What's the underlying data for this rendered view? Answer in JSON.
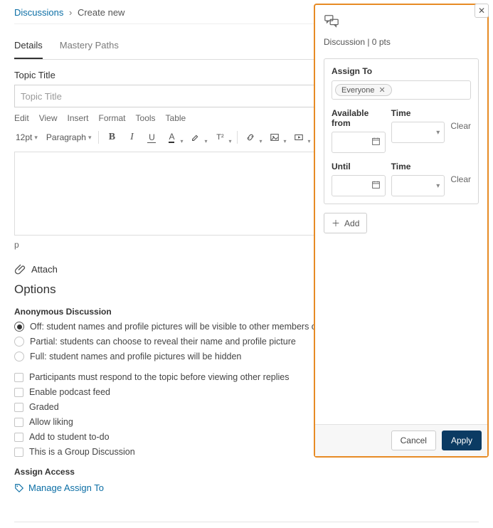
{
  "breadcrumb": {
    "root": "Discussions",
    "sep": "›",
    "current": "Create new"
  },
  "tabs": {
    "details": "Details",
    "mastery": "Mastery Paths"
  },
  "topic": {
    "label": "Topic Title",
    "placeholder": "Topic Title"
  },
  "editor": {
    "menus": [
      "Edit",
      "View",
      "Insert",
      "Format",
      "Tools",
      "Table"
    ],
    "fontsize": "12pt",
    "blocktype": "Paragraph",
    "sup": "T²",
    "status": "p"
  },
  "attach": {
    "label": "Attach"
  },
  "options": {
    "heading": "Options",
    "anon_heading": "Anonymous Discussion",
    "anon": {
      "off": "Off: student names and profile pictures will be visible to other members of this course",
      "partial": "Partial: students can choose to reveal their name and profile picture",
      "full": "Full: student names and profile pictures will be hidden"
    },
    "checks": {
      "must_respond": "Participants must respond to the topic before viewing other replies",
      "podcast": "Enable podcast feed",
      "graded": "Graded",
      "liking": "Allow liking",
      "todo": "Add to student to-do",
      "group": "This is a Group Discussion"
    }
  },
  "assign_access": {
    "label": "Assign Access",
    "manage": "Manage Assign To"
  },
  "panel": {
    "title": "Discussion | 0 pts",
    "assign_to": "Assign To",
    "pill": "Everyone",
    "available_from": "Available from",
    "time": "Time",
    "until": "Until",
    "clear": "Clear",
    "add": "Add",
    "cancel": "Cancel",
    "apply": "Apply"
  }
}
